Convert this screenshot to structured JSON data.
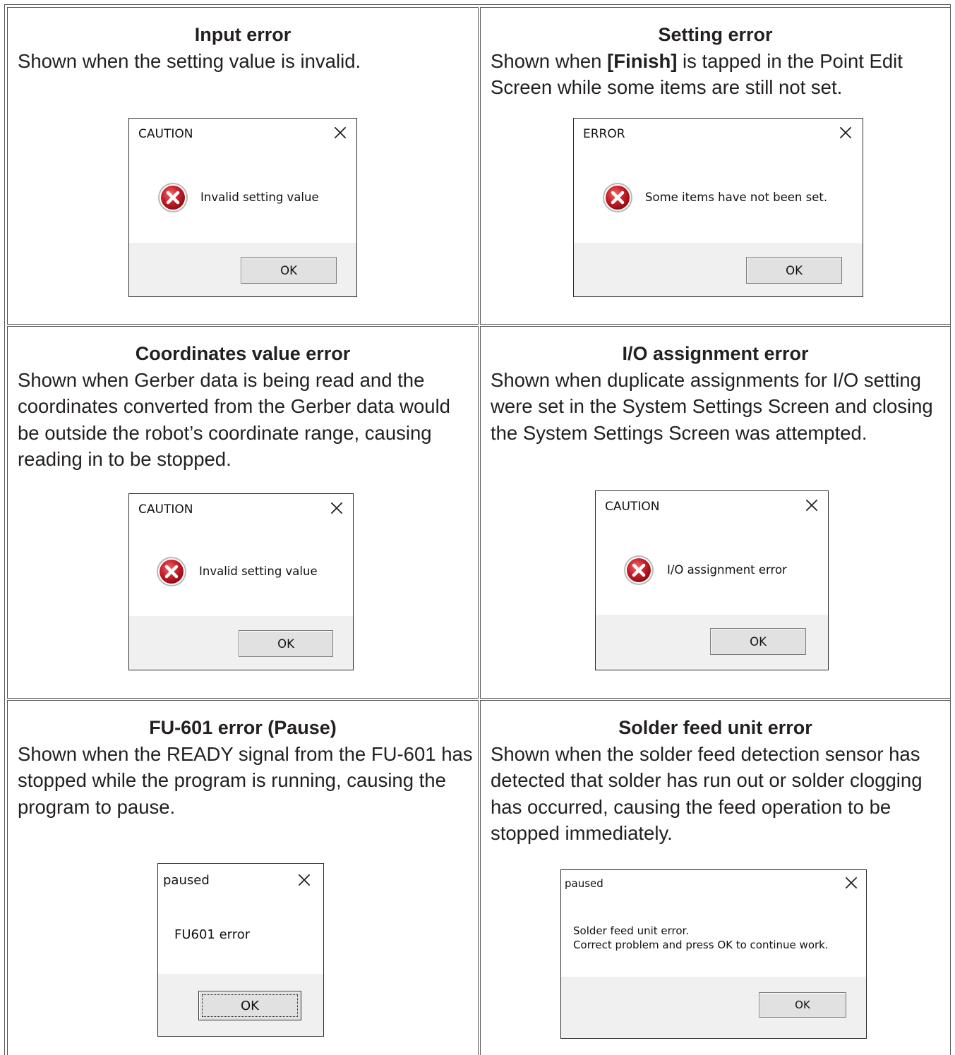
{
  "cells": [
    {
      "title": "Input error",
      "desc": "Shown when the setting value is invalid.",
      "dialog": {
        "title": "CAUTION",
        "message": "Invalid setting value",
        "ok": "OK"
      }
    },
    {
      "title": "Setting error",
      "desc_pre": "Shown when ",
      "desc_bold": "[Finish]",
      "desc_post": " is tapped in the Point Edit Screen while some items are still not set.",
      "dialog": {
        "title": "ERROR",
        "message": "Some items have not been set.",
        "ok": "OK"
      }
    },
    {
      "title": "Coordinates value error",
      "desc": "Shown when Gerber data is being read and the coordinates converted from the Gerber data would be outside the robot’s coordinate range, causing reading in to be stopped.",
      "dialog": {
        "title": "CAUTION",
        "message": "Invalid setting value",
        "ok": "OK"
      }
    },
    {
      "title": "I/O assignment error",
      "desc": "Shown when duplicate assignments for I/O setting were set in the System Settings Screen and closing the System Settings Screen was attempted.",
      "dialog": {
        "title": "CAUTION",
        "message": "I/O assignment error",
        "ok": "OK"
      }
    },
    {
      "title": "FU-601 error (Pause)",
      "desc": "Shown when the READY signal from the FU-601 has stopped while the program is running, causing the program to pause.",
      "dialog": {
        "title": "paused",
        "message": "FU601 error",
        "ok": "OK"
      }
    },
    {
      "title": "Solder feed unit error",
      "desc": "Shown when the solder feed detection sensor has detected that solder has run out or solder clogging has occurred, causing the feed operation to be stopped immediately.",
      "dialog": {
        "title": "paused",
        "message_line1": "Solder feed unit error.",
        "message_line2": "Correct problem and press OK to continue work.",
        "ok": "OK"
      }
    }
  ],
  "icons": {
    "error": "error-x-circle-icon",
    "close": "close-x-icon"
  },
  "colors": {
    "error_red": "#c8102e",
    "footer_gray": "#f0f0f0",
    "button_gray": "#e1e1e1"
  }
}
